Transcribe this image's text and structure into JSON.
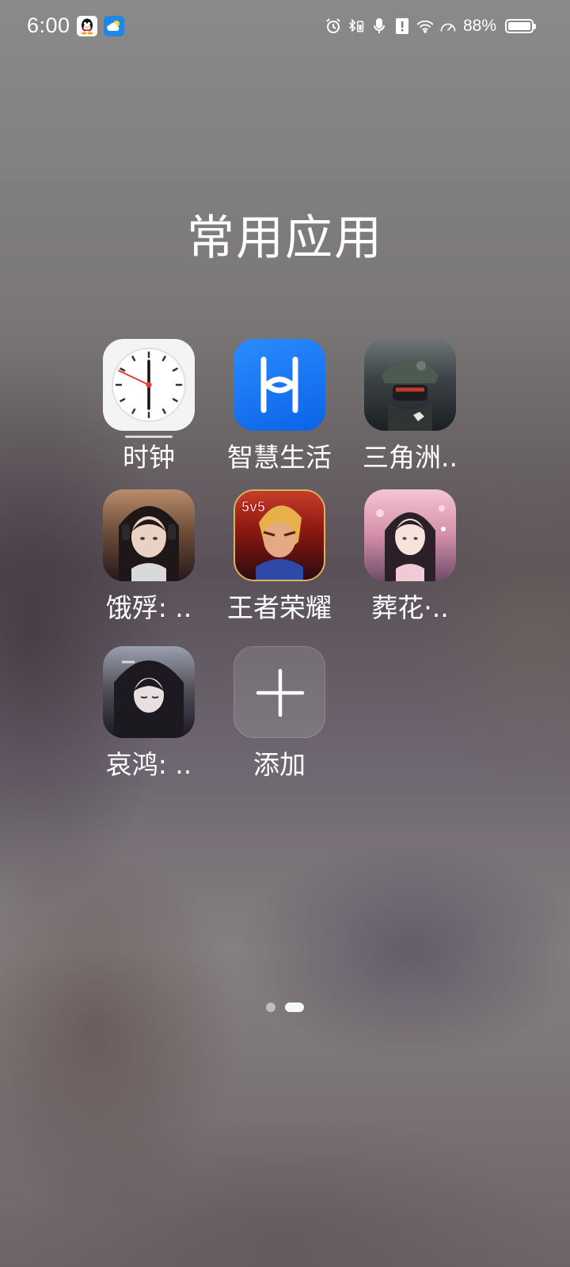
{
  "status_bar": {
    "time": "6:00",
    "notification_icons": [
      "qq-icon",
      "weather-icon"
    ],
    "system_icons": [
      "alarm-icon",
      "bluetooth-battery-icon",
      "microphone-icon",
      "alert-icon",
      "wifi-icon",
      "speed-icon"
    ],
    "battery_percent": "88%",
    "battery_level": 0.88
  },
  "folder": {
    "title": "常用应用",
    "apps": [
      {
        "label": "时钟",
        "icon": "clock-icon",
        "running": true
      },
      {
        "label": "智慧生活",
        "icon": "huawei-smart-life-icon"
      },
      {
        "label": "三角洲..",
        "icon": "delta-force-game-icon"
      },
      {
        "label": "饿殍: ..",
        "icon": "game-portrait-girl-icon"
      },
      {
        "label": "王者荣耀",
        "icon": "honor-of-kings-icon",
        "badge": "5v5"
      },
      {
        "label": "葬花·..",
        "icon": "game-zanghua-icon"
      },
      {
        "label": "哀鸿: ..",
        "icon": "game-aihong-icon"
      },
      {
        "label": "添加",
        "icon": "plus-icon"
      }
    ]
  },
  "page_indicator": {
    "pages": 2,
    "current": 2
  }
}
